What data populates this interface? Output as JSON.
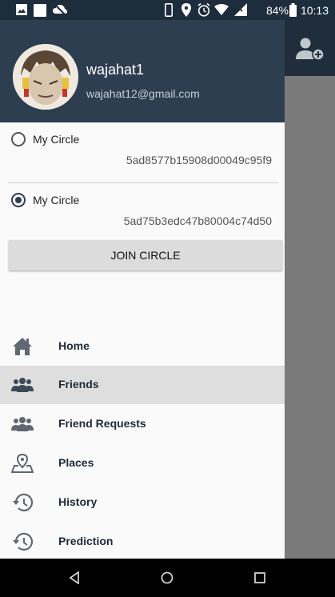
{
  "status_bar": {
    "battery": "84%",
    "time": "10:13"
  },
  "drawer": {
    "username": "wajahat1",
    "email": "wajahat12@gmail.com"
  },
  "circles": [
    {
      "name": "My Circle",
      "id": "5ad8577b15908d00049c95f9",
      "selected": false
    },
    {
      "name": "My Circle",
      "id": "5ad75b3edc47b80004c74d50",
      "selected": true
    }
  ],
  "join_button": "JOIN CIRCLE",
  "nav": [
    {
      "label": "Home",
      "icon": "home-icon",
      "active": false
    },
    {
      "label": "Friends",
      "icon": "people-icon",
      "active": true
    },
    {
      "label": "Friend Requests",
      "icon": "people-icon",
      "active": false
    },
    {
      "label": "Places",
      "icon": "map-pin-icon",
      "active": false
    },
    {
      "label": "History",
      "icon": "history-icon",
      "active": false
    },
    {
      "label": "Prediction",
      "icon": "history-icon",
      "active": false
    }
  ],
  "colors": {
    "header": "#2c3e50",
    "appbar": "#202d3a",
    "drawer_bg": "#fafafa",
    "active_item_bg": "#dedede",
    "scrim": "#7a7a7a"
  }
}
